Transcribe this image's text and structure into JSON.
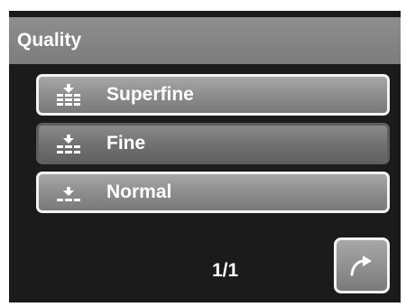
{
  "header": {
    "title": "Quality"
  },
  "menu": {
    "items": [
      {
        "label": "Superfine",
        "icon": "superfine-quality-icon",
        "selected": false
      },
      {
        "label": "Fine",
        "icon": "fine-quality-icon",
        "selected": true
      },
      {
        "label": "Normal",
        "icon": "normal-quality-icon",
        "selected": false
      }
    ]
  },
  "footer": {
    "page": "1/1",
    "return_icon": "return-arrow-icon"
  },
  "colors": {
    "screen_background": "#1b1b1b",
    "title_bar": "#8a8a8a",
    "item_border": "#f2f2f2",
    "selected_border": "#5e5e5e",
    "text": "#ffffff"
  }
}
